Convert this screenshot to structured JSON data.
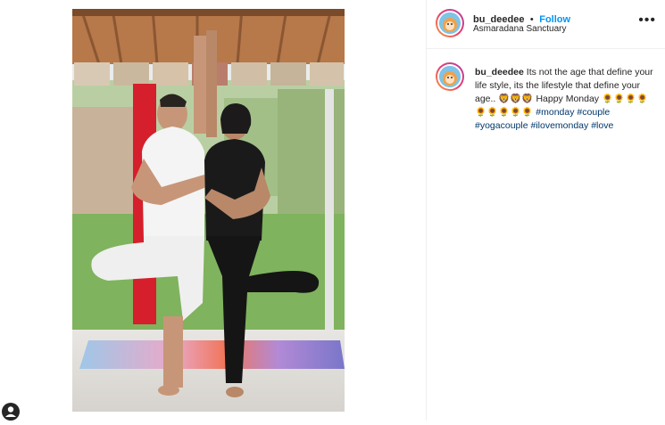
{
  "post": {
    "username": "bu_deedee",
    "separator": "•",
    "follow_label": "Follow",
    "location": "Asmaradana Sanctuary",
    "more_label": "•••"
  },
  "caption": {
    "username": "bu_deedee",
    "text": "Its not the age that define your life style, its the lifestyle that define your age..",
    "emojis_1": "🦁🦁🦁",
    "happy_monday": "Happy Monday",
    "emojis_2": "🌻🌻🌻🌻🌻🌻🌻🌻🌻",
    "hashtags": [
      "#monday",
      "#couple",
      "#yogacouple",
      "#ilovemonday",
      "#love"
    ]
  },
  "icons": {
    "more": "more-options-icon",
    "profile": "profile-icon"
  },
  "colors": {
    "link": "#0095f6",
    "hashtag": "#00376b",
    "text": "#262626"
  }
}
